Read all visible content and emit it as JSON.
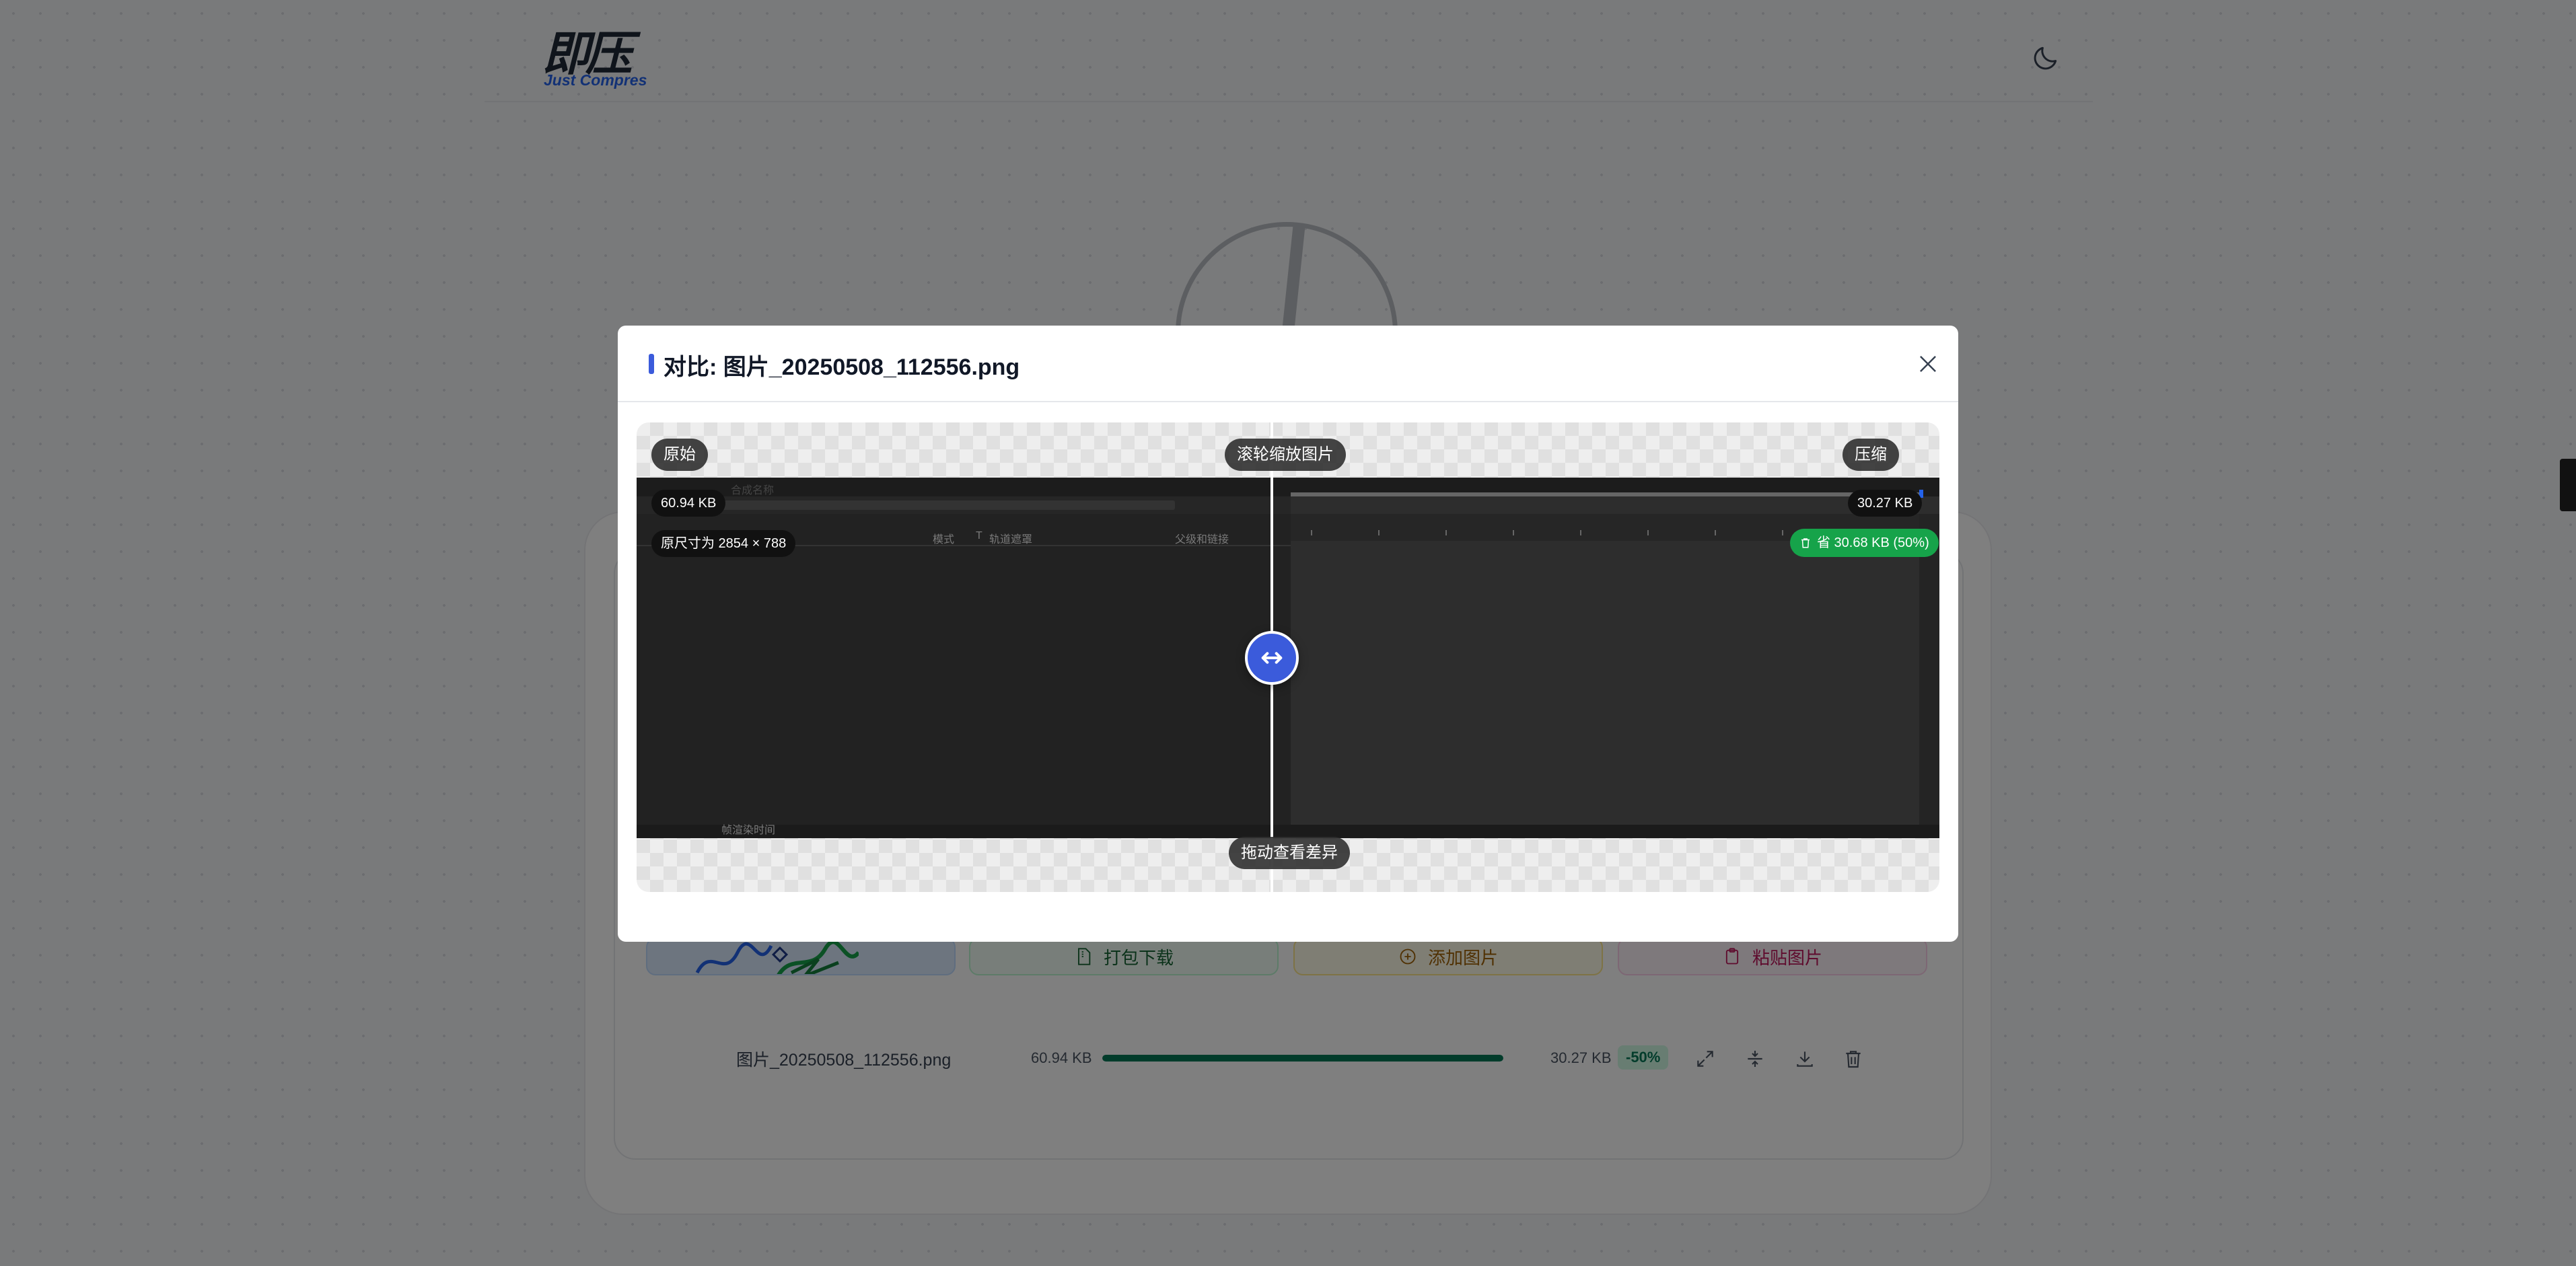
{
  "app": {
    "logo_text": "即压",
    "logo_subtitle": "Just Compres"
  },
  "actions": {
    "zip_label": "打包下载",
    "add_label": "添加图片",
    "paste_label": "粘贴图片"
  },
  "file_row": {
    "name": "图片_20250508_112556.png",
    "original_size": "60.94 KB",
    "compressed_size": "30.27 KB",
    "ratio_badge": "-50%",
    "progress_percent": 100
  },
  "modal": {
    "title": "对比: 图片_20250508_112556.png",
    "label_original": "原始",
    "label_compressed": "压缩",
    "label_zoom_hint": "滚轮缩放图片",
    "label_drag_hint": "拖动查看差异",
    "original_size": "60.94 KB",
    "compressed_size": "30.27 KB",
    "original_dimensions": "原尺寸为 2854 × 788",
    "saved_text": "省 30.68 KB (50%)"
  },
  "screenshot_text": {
    "toolbar_label": "模式",
    "toolbar_t": "T",
    "toolbar_track": "轨道遮罩",
    "toolbar_parent": "父级和链接",
    "bottom_label": "帧渲染时间",
    "top_label": "合成名称"
  },
  "colors": {
    "accent": "#3b5bdb",
    "success": "#16a34a",
    "progress": "#047857"
  },
  "icons": [
    "moon-icon",
    "close-icon",
    "swap-icon",
    "expand-icon",
    "compare-icon",
    "download-icon",
    "trash-icon",
    "file-zip-icon",
    "plus-circle-icon",
    "clipboard-icon",
    "trash-small-icon"
  ]
}
